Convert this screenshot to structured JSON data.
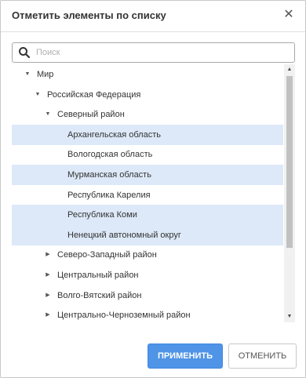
{
  "dialog": {
    "title": "Отметить элементы по списку",
    "close_label": "✕"
  },
  "search": {
    "placeholder": "Поиск",
    "value": ""
  },
  "tree": {
    "items": [
      {
        "label": "Мир",
        "level": 0,
        "expander": "expanded",
        "selected": false
      },
      {
        "label": "Российская Федерация",
        "level": 1,
        "expander": "expanded",
        "selected": false
      },
      {
        "label": "Северный район",
        "level": 2,
        "expander": "expanded",
        "selected": false
      },
      {
        "label": "Архангельская область",
        "level": 3,
        "expander": "none",
        "selected": true
      },
      {
        "label": "Вологодская область",
        "level": 3,
        "expander": "none",
        "selected": false
      },
      {
        "label": "Мурманская область",
        "level": 3,
        "expander": "none",
        "selected": true
      },
      {
        "label": "Республика Карелия",
        "level": 3,
        "expander": "none",
        "selected": false
      },
      {
        "label": "Республика Коми",
        "level": 3,
        "expander": "none",
        "selected": true
      },
      {
        "label": "Ненецкий автономный округ",
        "level": 3,
        "expander": "none",
        "selected": true
      },
      {
        "label": "Северо-Западный район",
        "level": 2,
        "expander": "collapsed",
        "selected": false
      },
      {
        "label": "Центральный район",
        "level": 2,
        "expander": "collapsed",
        "selected": false
      },
      {
        "label": "Волго-Вятский район",
        "level": 2,
        "expander": "collapsed",
        "selected": false
      },
      {
        "label": "Центрально-Черноземный район",
        "level": 2,
        "expander": "collapsed",
        "selected": false
      }
    ]
  },
  "buttons": {
    "apply": "ПРИМЕНИТЬ",
    "cancel": "ОТМЕНИТЬ"
  },
  "colors": {
    "selected_row": "#dde9f8",
    "primary_button": "#4f94e6"
  },
  "icons": {
    "search": "magnifier-icon",
    "expanded": "triangle-down-icon",
    "collapsed": "triangle-right-icon",
    "close": "close-icon"
  }
}
